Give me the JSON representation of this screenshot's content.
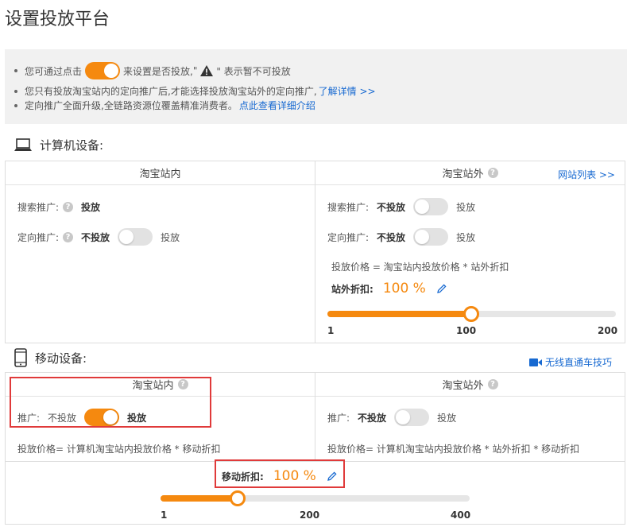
{
  "page_title": "设置投放平台",
  "tips": {
    "line1_pre": "您可通过点击",
    "line1_mid": "来设置是否投放,",
    "line1_quote_open": "\"",
    "line1_quote_close": "\" 表示暂不可投放",
    "line2_text": "您只有投放淘宝站内的定向推广后,才能选择投放淘宝站外的定向推广,",
    "line2_link": "了解详情 >>",
    "line3_text": "定向推广全面升级,全链路资源位覆盖精准消费者。",
    "line3_link": "点此查看详细介绍"
  },
  "computer": {
    "section_title": "计算机设备:",
    "onsite": {
      "title": "淘宝站内",
      "search_label": "搜索推广:",
      "search_value": "投放",
      "target_label": "定向推广:",
      "target_off": "不投放",
      "target_on": "投放"
    },
    "offsite": {
      "title": "淘宝站外",
      "site_list_link": "网站列表 >>",
      "search_label": "搜索推广:",
      "search_off": "不投放",
      "search_on": "投放",
      "target_label": "定向推广:",
      "target_off": "不投放",
      "target_on": "投放",
      "formula": "投放价格 = 淘宝站内投放价格 * 站外折扣",
      "discount_label": "站外折扣:",
      "discount_value": "100 %",
      "slider": {
        "min": "1",
        "mid": "100",
        "max": "200",
        "value": 100,
        "min_num": 1,
        "max_num": 200
      }
    }
  },
  "mobile": {
    "section_title": "移动设备:",
    "tips_link": "无线直通车技巧",
    "onsite": {
      "title": "淘宝站内",
      "promo_label": "推广:",
      "promo_off": "不投放",
      "promo_on": "投放",
      "formula": "投放价格= 计算机淘宝站内投放价格 * 移动折扣"
    },
    "offsite": {
      "title": "淘宝站外",
      "promo_label": "推广:",
      "promo_off": "不投放",
      "promo_on": "投放",
      "formula": "投放价格= 计算机淘宝站内投放价格 * 站外折扣 * 移动折扣"
    },
    "discount_label": "移动折扣:",
    "discount_value": "100 %",
    "slider": {
      "min": "1",
      "mid": "200",
      "max": "400",
      "value": 100,
      "min_num": 1,
      "max_num": 400
    }
  },
  "colors": {
    "accent": "#f5890f",
    "link": "#1769d1",
    "highlight_box": "#e03a3a"
  }
}
